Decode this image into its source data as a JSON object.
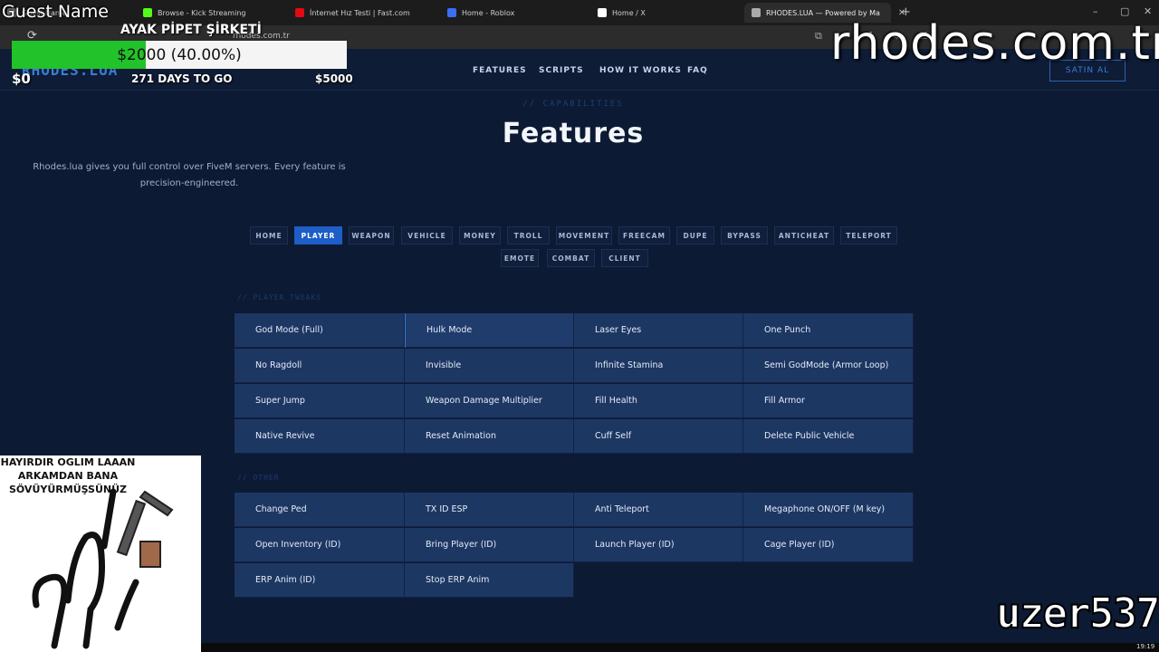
{
  "browser": {
    "tabs": [
      {
        "label": "Guest Name",
        "favicon_color": "#777777"
      },
      {
        "label": "Browse - Kick Streaming",
        "favicon_color": "#53fc18"
      },
      {
        "label": "İnternet Hız Testi | Fast.com",
        "favicon_color": "#e50914"
      },
      {
        "label": "Home - Roblox",
        "favicon_color": "#3b6df5"
      },
      {
        "label": "Home / X",
        "favicon_color": "#ffffff"
      },
      {
        "label": "RHODES.LUA — Powered by Ma",
        "favicon_color": "#aaaaaa",
        "active": true
      }
    ],
    "new_tab": "+",
    "window_controls": [
      "–",
      "▢",
      "✕"
    ],
    "url": "rhodes.com.tr"
  },
  "site": {
    "logo": "RHODES.LUA",
    "nav": [
      "FEATURES",
      "SCRIPTS",
      "HOW IT WORKS",
      "FAQ"
    ],
    "buy_label": "SATIN AL",
    "eyebrow": "// CAPABILITIES",
    "title": "Features",
    "description": "Rhodes.lua gives you full control over FiveM servers. Every feature is precision-engineered.",
    "categories_row1": [
      "HOME",
      "PLAYER",
      "WEAPON",
      "VEHICLE",
      "MONEY",
      "TROLL",
      "MOVEMENT",
      "FREECAM",
      "DUPE",
      "BYPASS",
      "ANTICHEAT",
      "TELEPORT"
    ],
    "categories_row2": [
      "EMOTE",
      "COMBAT",
      "CLIENT"
    ],
    "active_category": "PLAYER",
    "sections": [
      {
        "label": "// PLAYER TWEAKS",
        "items": [
          "God Mode (Full)",
          "Hulk Mode",
          "Laser Eyes",
          "One Punch",
          "No Ragdoll",
          "Invisible",
          "Infinite Stamina",
          "Semi GodMode (Armor Loop)",
          "Super Jump",
          "Weapon Damage Multiplier",
          "Fill Health",
          "Fill Armor",
          "Native Revive",
          "Reset Animation",
          "Cuff Self",
          "Delete Public Vehicle"
        ]
      },
      {
        "label": "// OTHER",
        "items": [
          "Change Ped",
          "TX ID ESP",
          "Anti Teleport",
          "Megaphone ON/OFF (M key)",
          "Open Inventory (ID)",
          "Bring Player (ID)",
          "Launch Player (ID)",
          "Cage Player (ID)",
          "ERP Anim (ID)",
          "Stop ERP Anim"
        ]
      }
    ]
  },
  "overlay": {
    "guest_name": "Guest Name",
    "company": "AYAK PİPET ŞİRKETİ",
    "goal_progress_text": "$2000 (40.00%)",
    "goal_progress": 0.4,
    "goal_start": "$0",
    "days_left": "271 DAYS TO GO",
    "goal_end": "$5000",
    "watermark": "rhodes.com.tr",
    "meme_text": "HAYIRDIR OGLIM LAAAN ARKAMDAN BANA SÖVÜYÜRMÜŞSÜNÜZ",
    "handle": "uzer537"
  },
  "taskbar": {
    "clock": "19:19"
  },
  "colors": {
    "accent": "#1d5ec8",
    "background": "#0d1a33",
    "cell": "#1d3763",
    "progress": "#22c22a"
  }
}
